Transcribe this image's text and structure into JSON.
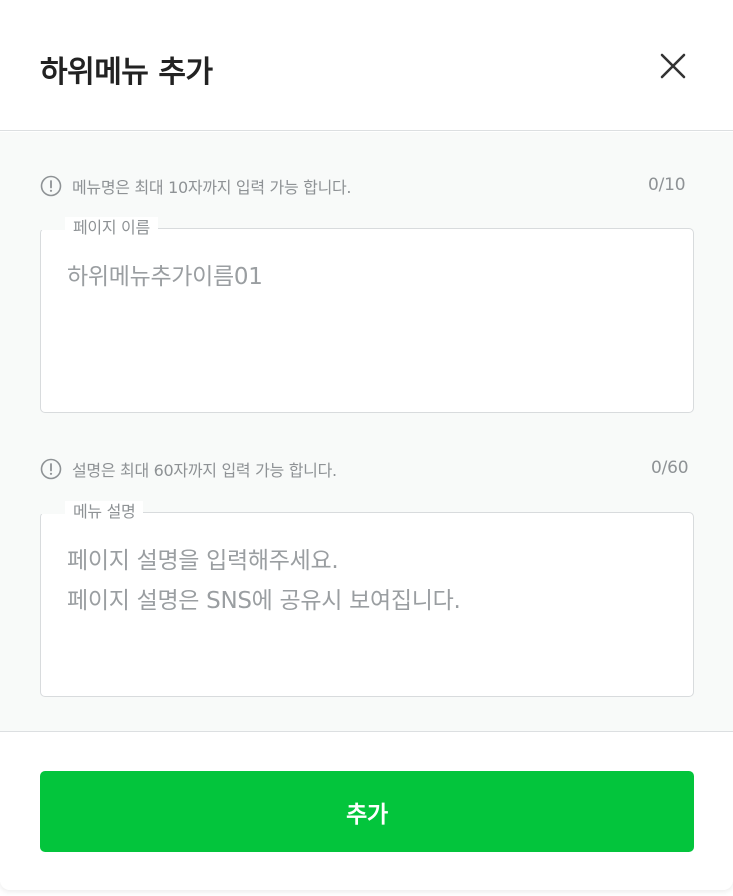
{
  "dialog": {
    "title": "하위메뉴 추가",
    "close_icon": "close-icon"
  },
  "page_name": {
    "hint": "메뉴명은 최대 10자까지 입력 가능 합니다.",
    "counter": "0/10",
    "legend": "페이지 이름",
    "placeholder": "하위메뉴추가이름01"
  },
  "menu_description": {
    "hint": "설명은 최대 60자까지 입력 가능 합니다.",
    "counter": "0/60",
    "legend": "메뉴 설명",
    "placeholder": "페이지 설명을 입력해주세요.\n페이지 설명은 SNS에 공유시 보여집니다."
  },
  "footer": {
    "submit_label": "추가"
  },
  "colors": {
    "primary": "#03c53c",
    "muted_text": "#8e9295",
    "border": "#d8dbdd"
  }
}
